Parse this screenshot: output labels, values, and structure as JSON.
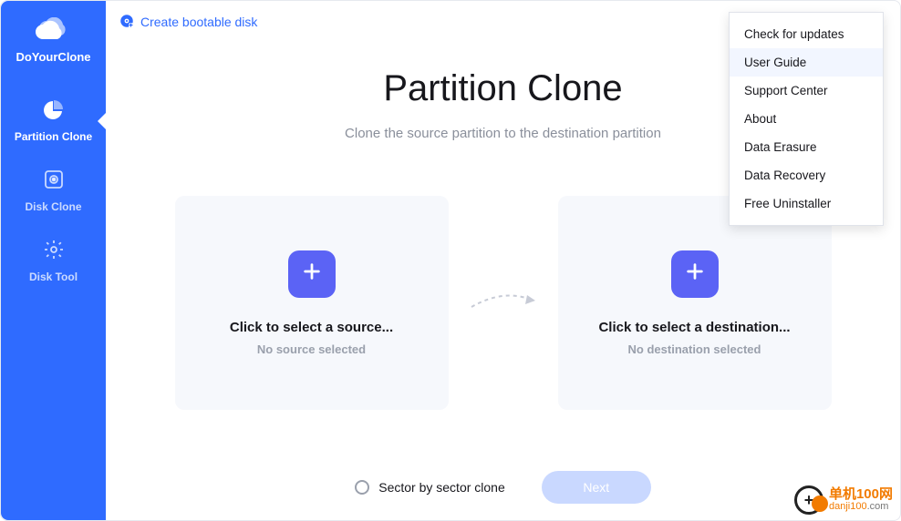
{
  "brand": "DoYourClone",
  "top_link": "Create bootable disk",
  "sidebar": {
    "items": [
      {
        "label": "Partition Clone"
      },
      {
        "label": "Disk Clone"
      },
      {
        "label": "Disk Tool"
      }
    ]
  },
  "page": {
    "title": "Partition Clone",
    "subtitle": "Clone the source partition to the destination partition"
  },
  "source_card": {
    "title": "Click to select a source...",
    "sub": "No source selected"
  },
  "dest_card": {
    "title": "Click to select a destination...",
    "sub": "No destination selected"
  },
  "sector_label": "Sector by sector clone",
  "next_label": "Next",
  "menu": {
    "items": [
      "Check for updates",
      "User Guide",
      "Support Center",
      "About",
      "Data Erasure",
      "Data Recovery",
      "Free Uninstaller"
    ],
    "highlight_index": 1
  },
  "watermark": {
    "cn": "单机100网",
    "url_prefix": "danji100",
    "url_suffix": ".com"
  }
}
